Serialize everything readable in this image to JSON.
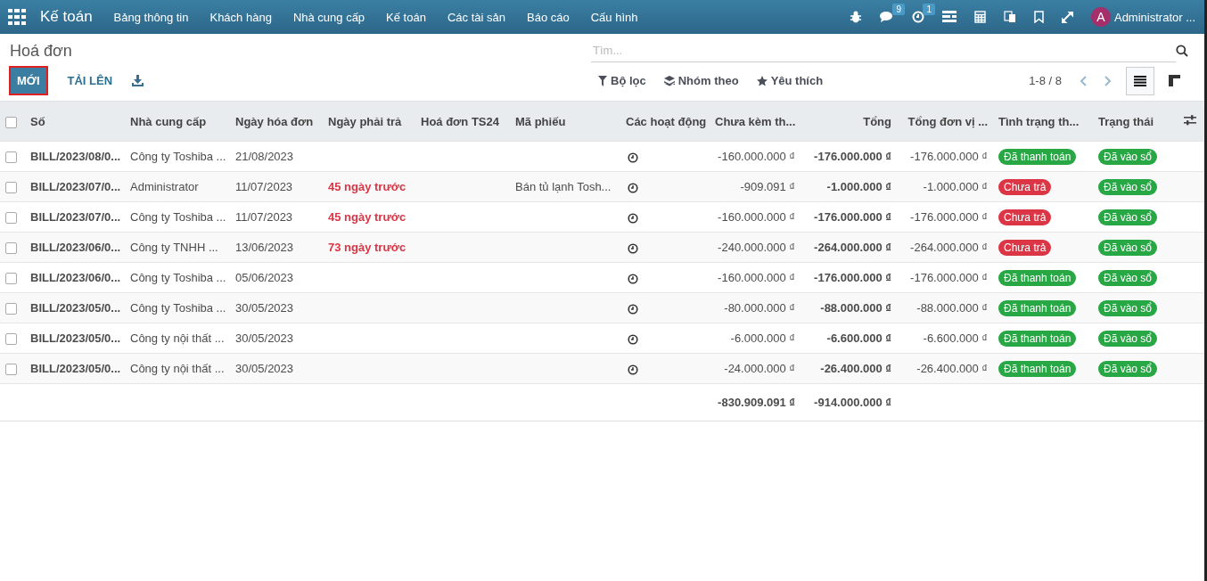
{
  "navbar": {
    "app": "Kế toán",
    "menu": [
      "Bảng thông tin",
      "Khách hàng",
      "Nhà cung cấp",
      "Kế toán",
      "Các tài sản",
      "Báo cáo",
      "Cấu hình"
    ],
    "messages_badge": "9",
    "activities_badge": "1",
    "user": {
      "initial": "A",
      "name": "Administrator ..."
    }
  },
  "control_panel": {
    "title": "Hoá đơn",
    "buttons": [
      "MỚI",
      "TẢI LÊN"
    ],
    "search": {
      "placeholder": "Tìm..."
    },
    "filters": [
      "Bộ lọc",
      "Nhóm theo",
      "Yêu thích"
    ],
    "pager": "1-8 / 8",
    "views": [
      {
        "kind": "list",
        "selected": true
      },
      {
        "kind": "kanban",
        "selected": false
      }
    ]
  },
  "table": {
    "select_all": {
      "checked": false
    },
    "columns": [
      {
        "label": "Số",
        "kind": "text"
      },
      {
        "label": "Nhà cung cấp",
        "kind": "text"
      },
      {
        "label": "Ngày hóa đơn",
        "kind": "text"
      },
      {
        "label": "Ngày phải trả",
        "kind": "text"
      },
      {
        "label": "Hoá đơn TS24",
        "kind": "text"
      },
      {
        "label": "Mã phiếu",
        "kind": "text"
      },
      {
        "label": "Các hoạt động",
        "kind": "text"
      },
      {
        "label": "Chưa kèm th...",
        "kind": "amount"
      },
      {
        "label": "Tổng",
        "kind": "amount"
      },
      {
        "label": "Tổng đơn vị ...",
        "kind": "amount"
      },
      {
        "label": "Tình trạng th...",
        "kind": "text"
      },
      {
        "label": "Trạng thái",
        "kind": "text"
      }
    ],
    "rows": [
      {
        "checked": false,
        "number": "BILL/2023/08/0...",
        "vendor": "Công ty Toshiba ...",
        "invoice_date": "21/08/2023",
        "untaxed": "-160.000.000 ₫",
        "total": "-176.000.000 ₫",
        "total_currency": "-176.000.000 ₫",
        "payment_status": {
          "label": "Đã thanh toán",
          "color": "#28a745"
        },
        "state": {
          "label": "Đã vào sổ",
          "color": "#28a745"
        }
      },
      {
        "checked": false,
        "number": "BILL/2023/07/0...",
        "vendor": "Administrator",
        "invoice_date": "11/07/2023",
        "due": {
          "text": "45 ngày trước",
          "overdue": true
        },
        "reference": "Bán tủ lạnh Tosh...",
        "untaxed": "-909.091 ₫",
        "total": "-1.000.000 ₫",
        "total_currency": "-1.000.000 ₫",
        "payment_status": {
          "label": "Chưa trả",
          "color": "#dc3545"
        },
        "state": {
          "label": "Đã vào sổ",
          "color": "#28a745"
        }
      },
      {
        "checked": false,
        "number": "BILL/2023/07/0...",
        "vendor": "Công ty Toshiba ...",
        "invoice_date": "11/07/2023",
        "due": {
          "text": "45 ngày trước",
          "overdue": true
        },
        "untaxed": "-160.000.000 ₫",
        "total": "-176.000.000 ₫",
        "total_currency": "-176.000.000 ₫",
        "payment_status": {
          "label": "Chưa trả",
          "color": "#dc3545"
        },
        "state": {
          "label": "Đã vào sổ",
          "color": "#28a745"
        }
      },
      {
        "checked": false,
        "number": "BILL/2023/06/0...",
        "vendor": "Công ty TNHH ...",
        "invoice_date": "13/06/2023",
        "due": {
          "text": "73 ngày trước",
          "overdue": true
        },
        "untaxed": "-240.000.000 ₫",
        "total": "-264.000.000 ₫",
        "total_currency": "-264.000.000 ₫",
        "payment_status": {
          "label": "Chưa trả",
          "color": "#dc3545"
        },
        "state": {
          "label": "Đã vào sổ",
          "color": "#28a745"
        }
      },
      {
        "checked": false,
        "number": "BILL/2023/06/0...",
        "vendor": "Công ty Toshiba ...",
        "invoice_date": "05/06/2023",
        "untaxed": "-160.000.000 ₫",
        "total": "-176.000.000 ₫",
        "total_currency": "-176.000.000 ₫",
        "payment_status": {
          "label": "Đã thanh toán",
          "color": "#28a745"
        },
        "state": {
          "label": "Đã vào sổ",
          "color": "#28a745"
        }
      },
      {
        "checked": false,
        "number": "BILL/2023/05/0...",
        "vendor": "Công ty Toshiba ...",
        "invoice_date": "30/05/2023",
        "untaxed": "-80.000.000 ₫",
        "total": "-88.000.000 ₫",
        "total_currency": "-88.000.000 ₫",
        "payment_status": {
          "label": "Đã thanh toán",
          "color": "#28a745"
        },
        "state": {
          "label": "Đã vào sổ",
          "color": "#28a745"
        }
      },
      {
        "checked": false,
        "number": "BILL/2023/05/0...",
        "vendor": "Công ty nội thất ...",
        "invoice_date": "30/05/2023",
        "untaxed": "-6.000.000 ₫",
        "total": "-6.600.000 ₫",
        "total_currency": "-6.600.000 ₫",
        "payment_status": {
          "label": "Đã thanh toán",
          "color": "#28a745"
        },
        "state": {
          "label": "Đã vào sổ",
          "color": "#28a745"
        }
      },
      {
        "checked": false,
        "number": "BILL/2023/05/0...",
        "vendor": "Công ty nội thất ...",
        "invoice_date": "30/05/2023",
        "untaxed": "-24.000.000 ₫",
        "total": "-26.400.000 ₫",
        "total_currency": "-26.400.000 ₫",
        "payment_status": {
          "label": "Đã thanh toán",
          "color": "#28a745"
        },
        "state": {
          "label": "Đã vào sổ",
          "color": "#28a745"
        }
      }
    ],
    "totals": {
      "untaxed": "-830.909.091 ₫",
      "total": "-914.000.000 ₫"
    }
  }
}
